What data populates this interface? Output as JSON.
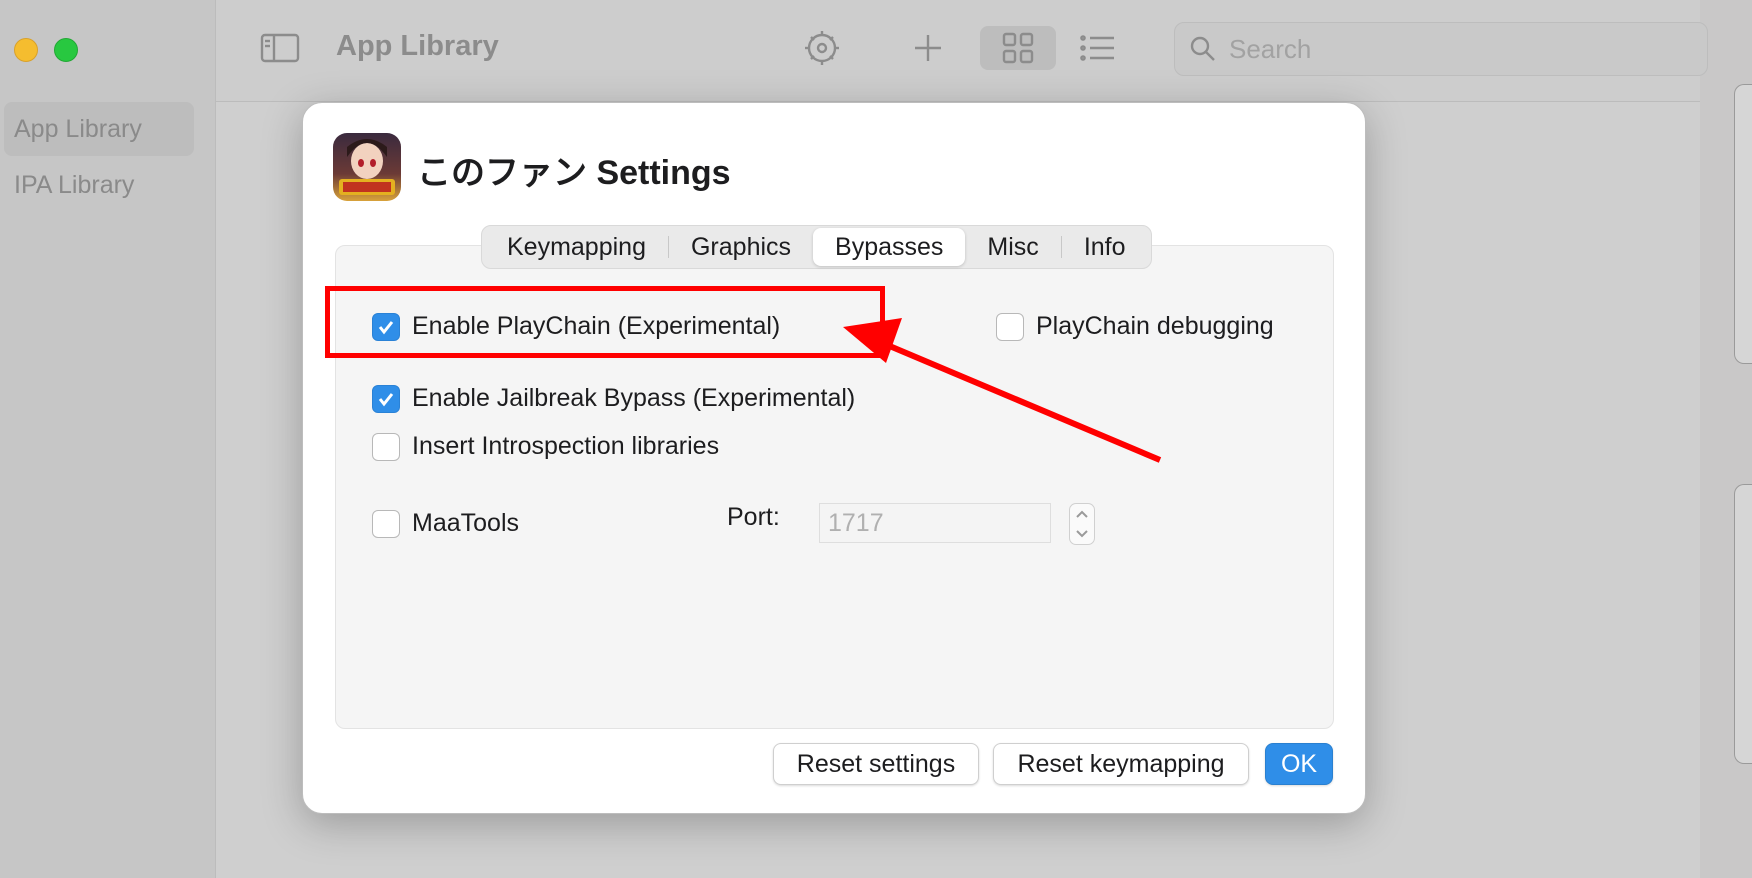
{
  "window": {
    "toolbar_title": "App Library",
    "search_placeholder": "Search",
    "sidebar": [
      {
        "label": "App Library",
        "active": true
      },
      {
        "label": "IPA Library",
        "active": false
      }
    ]
  },
  "dialog": {
    "title": "このファン Settings",
    "tabs": [
      {
        "label": "Keymapping",
        "active": false
      },
      {
        "label": "Graphics",
        "active": false
      },
      {
        "label": "Bypasses",
        "active": true
      },
      {
        "label": "Misc",
        "active": false
      },
      {
        "label": "Info",
        "active": false
      }
    ],
    "options": {
      "playchain": {
        "label": "Enable PlayChain (Experimental)",
        "checked": true
      },
      "playchain_debug": {
        "label": "PlayChain debugging",
        "checked": false
      },
      "jailbreak": {
        "label": "Enable Jailbreak Bypass (Experimental)",
        "checked": true
      },
      "introspection": {
        "label": "Insert Introspection libraries",
        "checked": false
      },
      "maatools": {
        "label": "MaaTools",
        "checked": false
      }
    },
    "port": {
      "label": "Port:",
      "placeholder": "1717"
    },
    "buttons": {
      "reset_settings": "Reset settings",
      "reset_keymapping": "Reset keymapping",
      "ok": "OK"
    }
  },
  "annotation": {
    "color": "#ff0000"
  }
}
